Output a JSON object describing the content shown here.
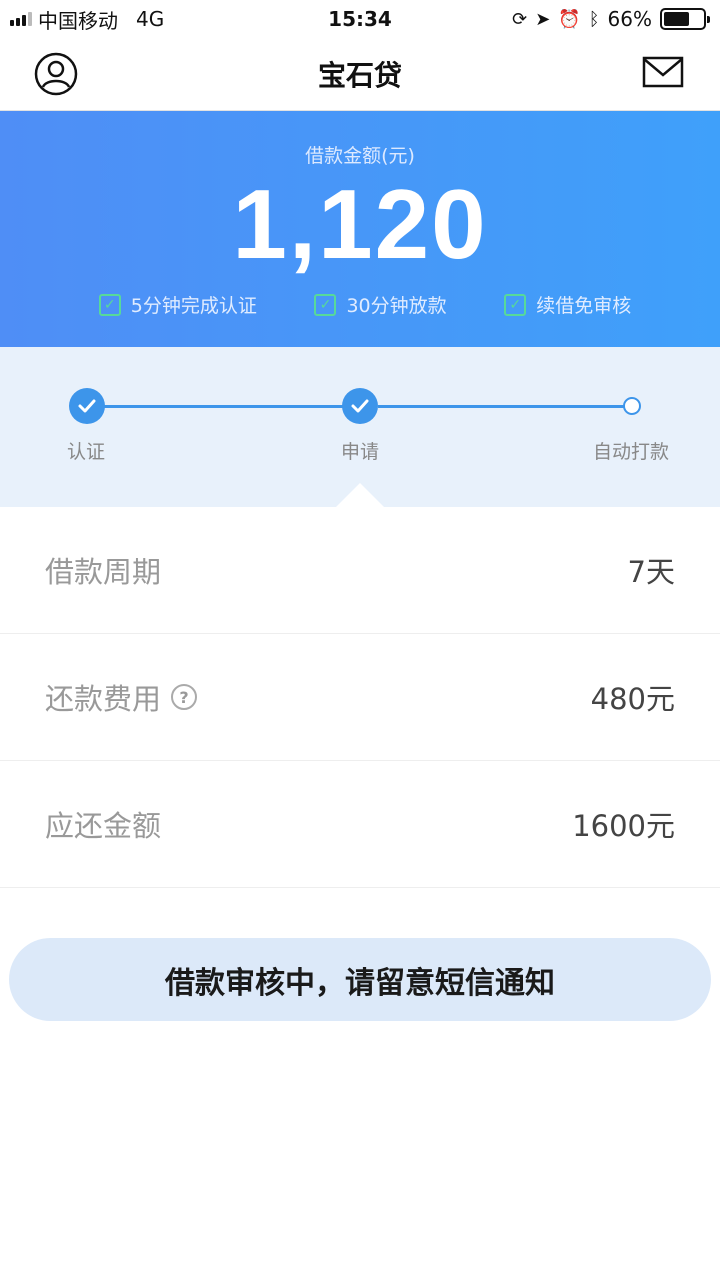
{
  "status_bar": {
    "carrier": "中国移动",
    "network": "4G",
    "time": "15:34",
    "battery_percent": "66%",
    "battery_level": 0.66
  },
  "nav": {
    "title": "宝石贷",
    "left_icon": "user-avatar-icon",
    "right_icon": "mail-icon"
  },
  "hero": {
    "label": "借款金额(元)",
    "amount": "1,120",
    "features": [
      {
        "label": "5分钟完成认证"
      },
      {
        "label": "30分钟放款"
      },
      {
        "label": "续借免审核"
      }
    ]
  },
  "steps": [
    {
      "label": "认证",
      "done": true
    },
    {
      "label": "申请",
      "done": true
    },
    {
      "label": "自动打款",
      "done": false
    }
  ],
  "details": [
    {
      "label": "借款周期",
      "value": "7天",
      "help": false
    },
    {
      "label": "还款费用",
      "value": "480元",
      "help": true
    },
    {
      "label": "应还金额",
      "value": "1600元",
      "help": false
    }
  ],
  "status_button": {
    "label": "借款审核中，请留意短信通知"
  },
  "colors": {
    "primary": "#3d95ea",
    "hero_start": "#4f8ef6",
    "hero_end": "#3fa0fa",
    "check": "#57d99a"
  }
}
